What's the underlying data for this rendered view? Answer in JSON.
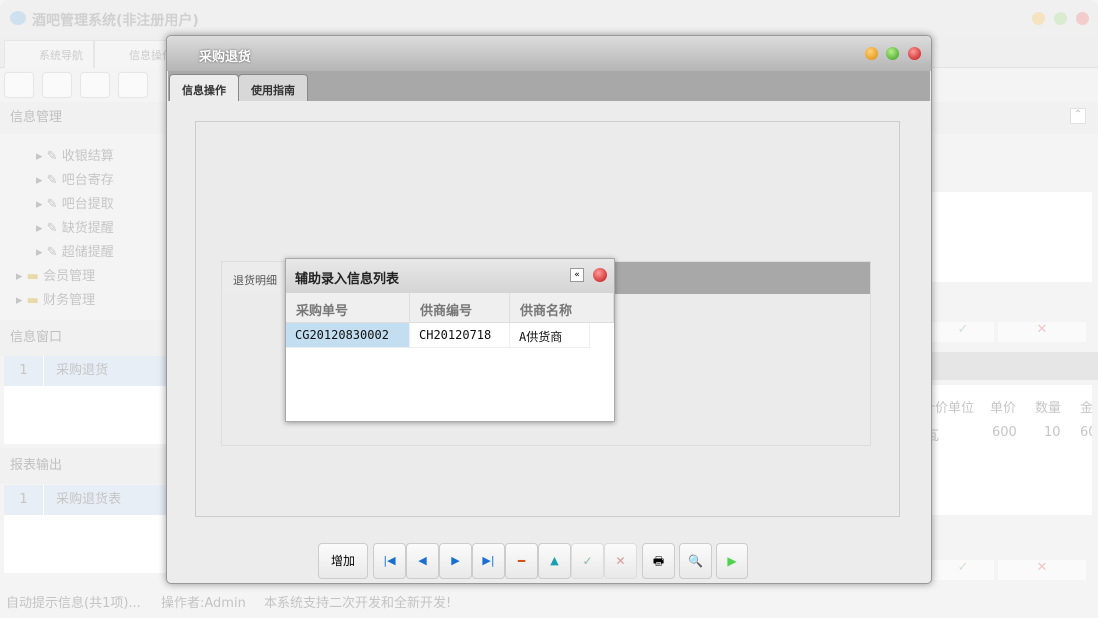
{
  "app": {
    "title": "酒吧管理系统(非注册用户)",
    "tabs": [
      "系统导航",
      "信息操作"
    ]
  },
  "sidebar": {
    "info_mgmt": "信息管理",
    "tree": [
      "收银结算",
      "吧台寄存",
      "吧台提取",
      "缺货提醒",
      "超储提醒"
    ],
    "folders": [
      "会员管理",
      "财务管理"
    ],
    "info_window": {
      "title": "信息窗口",
      "rows": [
        {
          "no": "1",
          "name": "采购退货"
        }
      ]
    },
    "report": {
      "title": "报表输出",
      "rows": [
        {
          "no": "1",
          "name": "采购退货表"
        }
      ]
    }
  },
  "right_table": {
    "headers": [
      "计价单位",
      "单价",
      "数量",
      "金"
    ],
    "row": [
      "瓦",
      "600",
      "10",
      "60"
    ]
  },
  "status": {
    "tip": "自动提示信息(共1项)...",
    "operator": "操作者:Admin",
    "slogan": "本系统支持二次开发和全新开发!"
  },
  "dialog": {
    "title": "采购退货",
    "tabs": [
      "信息操作",
      "使用指南"
    ],
    "sub_tab": "退货明细",
    "buttons": {
      "add": "增加"
    }
  },
  "popup": {
    "title": "辅助录入信息列表",
    "headers": [
      "采购单号",
      "供商编号",
      "供商名称"
    ],
    "rows": [
      [
        "CG20120830002",
        "CH20120718",
        "A供货商"
      ]
    ]
  }
}
